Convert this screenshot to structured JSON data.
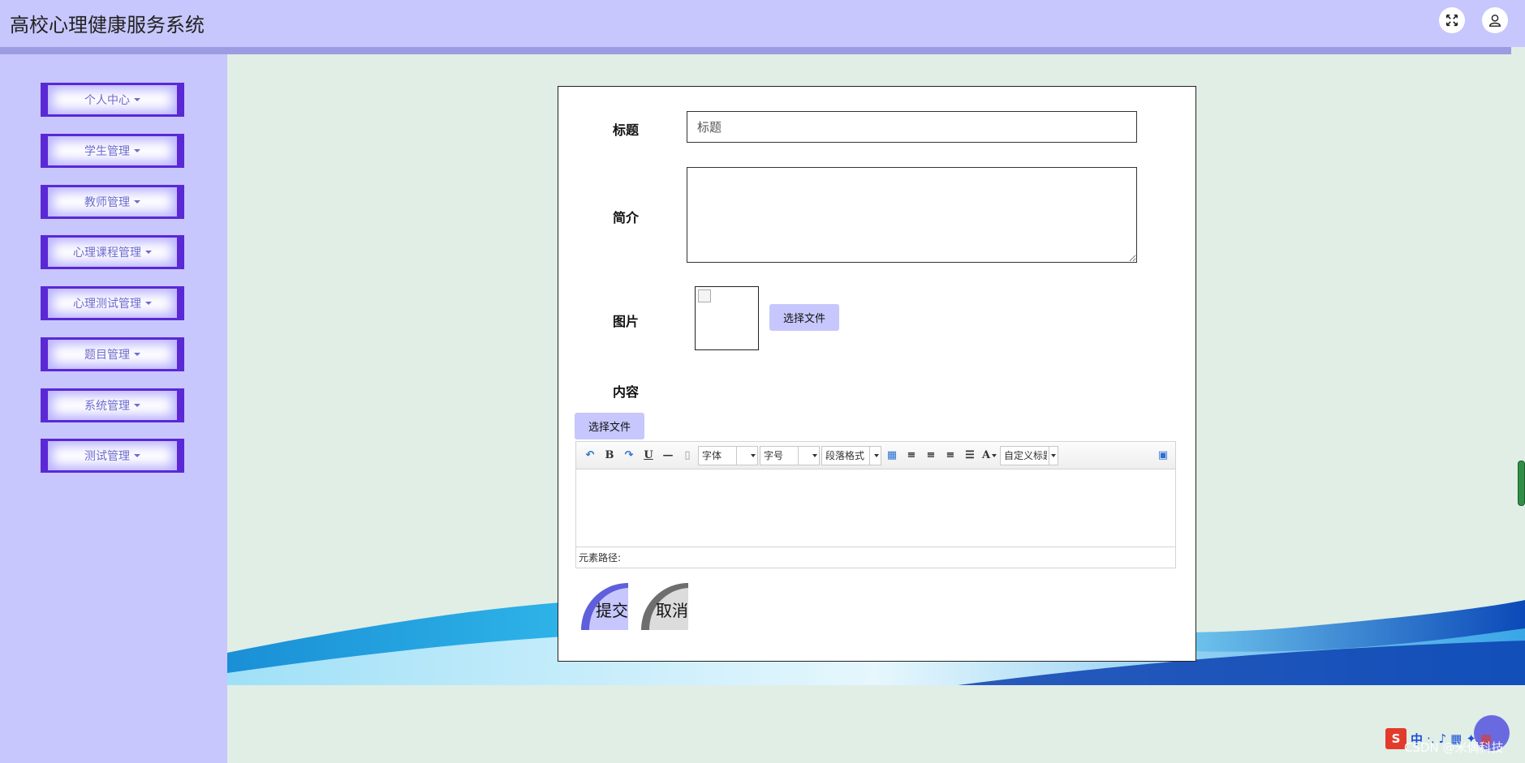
{
  "app": {
    "title": "高校心理健康服务系统"
  },
  "header": {
    "fullscreen_icon": "fullscreen-icon",
    "user_icon": "user-icon"
  },
  "sidebar": {
    "items": [
      {
        "label": "个人中心"
      },
      {
        "label": "学生管理"
      },
      {
        "label": "教师管理"
      },
      {
        "label": "心理课程管理"
      },
      {
        "label": "心理测试管理"
      },
      {
        "label": "题目管理"
      },
      {
        "label": "系统管理"
      },
      {
        "label": "测试管理"
      }
    ]
  },
  "form": {
    "title_label": "标题",
    "title_value": "标题",
    "intro_label": "简介",
    "intro_value": "",
    "image_label": "图片",
    "image_file_button": "选择文件",
    "content_label": "内容",
    "content_file_button": "选择文件",
    "submit_label": "提交",
    "cancel_label": "取消"
  },
  "editor": {
    "font_family_select": "字体",
    "font_size_select": "字号",
    "paragraph_select": "段落格式",
    "custom_title_select": "自定义标题",
    "text_color_glyph": "A",
    "bold_glyph": "B",
    "underline_glyph": "U",
    "element_path_label": "元素路径:"
  },
  "ime": {
    "logo": "S",
    "mode": "中"
  },
  "watermark": "CSDN @米偶科技",
  "colors": {
    "header_bg": "#c7c7fd",
    "accent_bar": "#9d9ce2",
    "menu_border": "#5b28d6",
    "page_bg": "#e0eee6",
    "submit_accent": "#5f5fdc",
    "cancel_accent": "#6e6e6e"
  }
}
